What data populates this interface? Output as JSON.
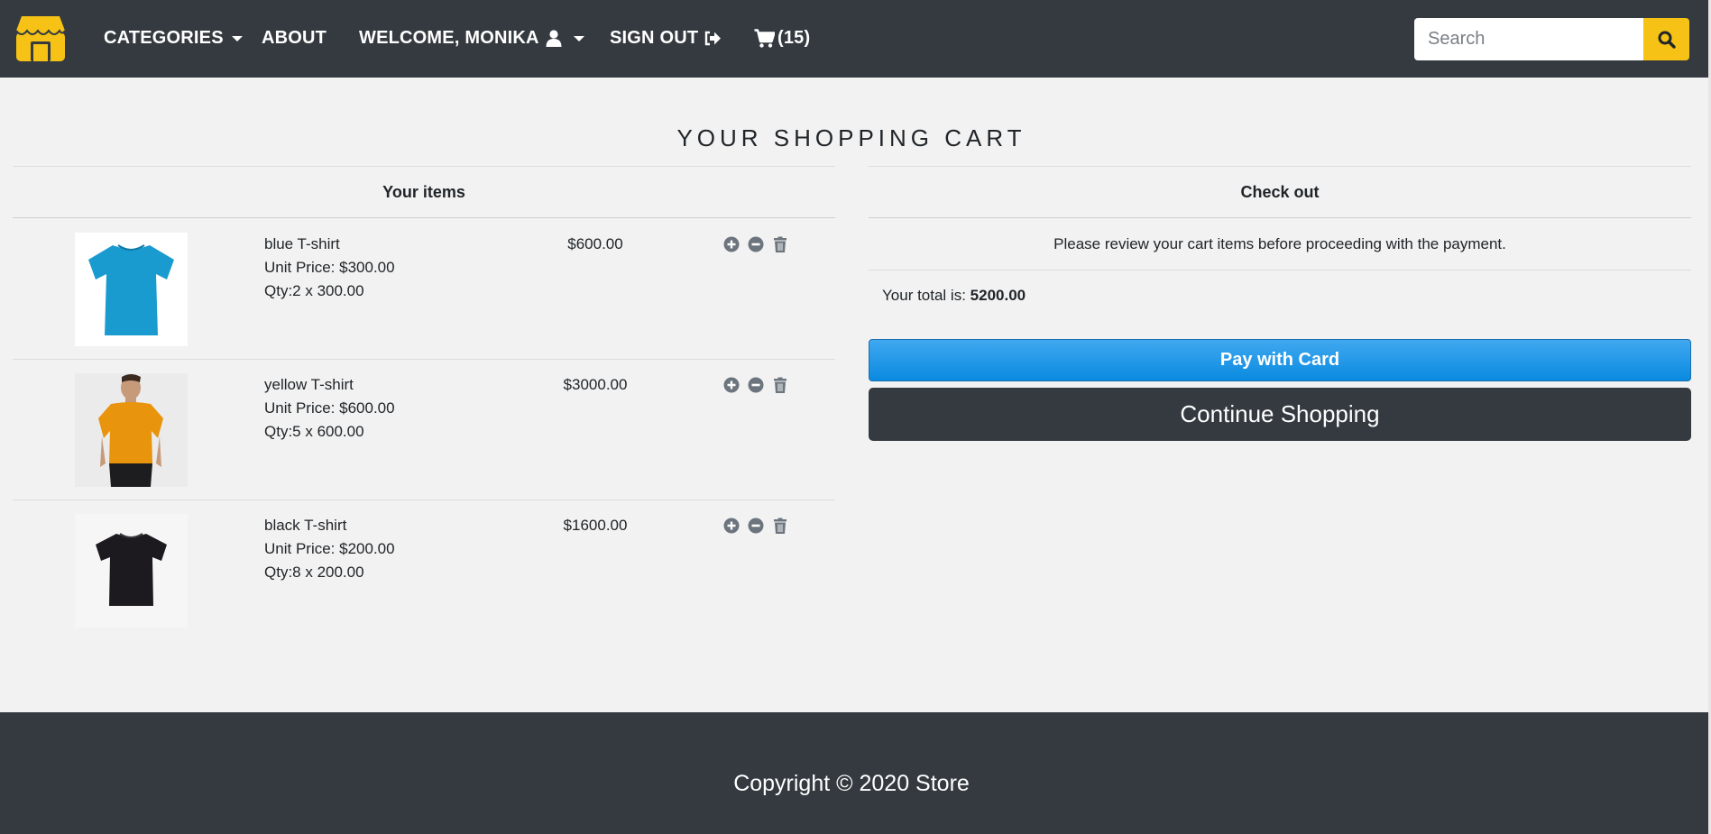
{
  "navbar": {
    "brand_color": "#f5c215",
    "categories_label": "CATEGORIES",
    "about_label": "ABOUT",
    "welcome_label": "WELCOME, MONIKA",
    "signout_label": "SIGN OUT",
    "cart_count_label": "(15)",
    "search_placeholder": "Search"
  },
  "page": {
    "title": "YOUR SHOPPING CART"
  },
  "items_section": {
    "heading": "Your items",
    "items": [
      {
        "name": "blue T-shirt",
        "unit_price": "Unit Price: $300.00",
        "qty": "Qty:2 x 300.00",
        "total": "$600.00",
        "shirt_color": "#1a9bd0"
      },
      {
        "name": "yellow T-shirt",
        "unit_price": "Unit Price: $600.00",
        "qty": "Qty:5 x 600.00",
        "total": "$3000.00",
        "shirt_color": "#e8940c"
      },
      {
        "name": "black T-shirt",
        "unit_price": "Unit Price: $200.00",
        "qty": "Qty:8 x 200.00",
        "total": "$1600.00",
        "shirt_color": "#1c1a1f"
      }
    ]
  },
  "checkout": {
    "heading": "Check out",
    "review_text": "Please review your cart items before proceeding with the payment.",
    "total_prefix": "Your total is:",
    "total_value": "5200.00",
    "pay_label": "Pay with Card",
    "continue_label": "Continue Shopping"
  },
  "footer": {
    "copyright": "Copyright © 2020 Store"
  }
}
